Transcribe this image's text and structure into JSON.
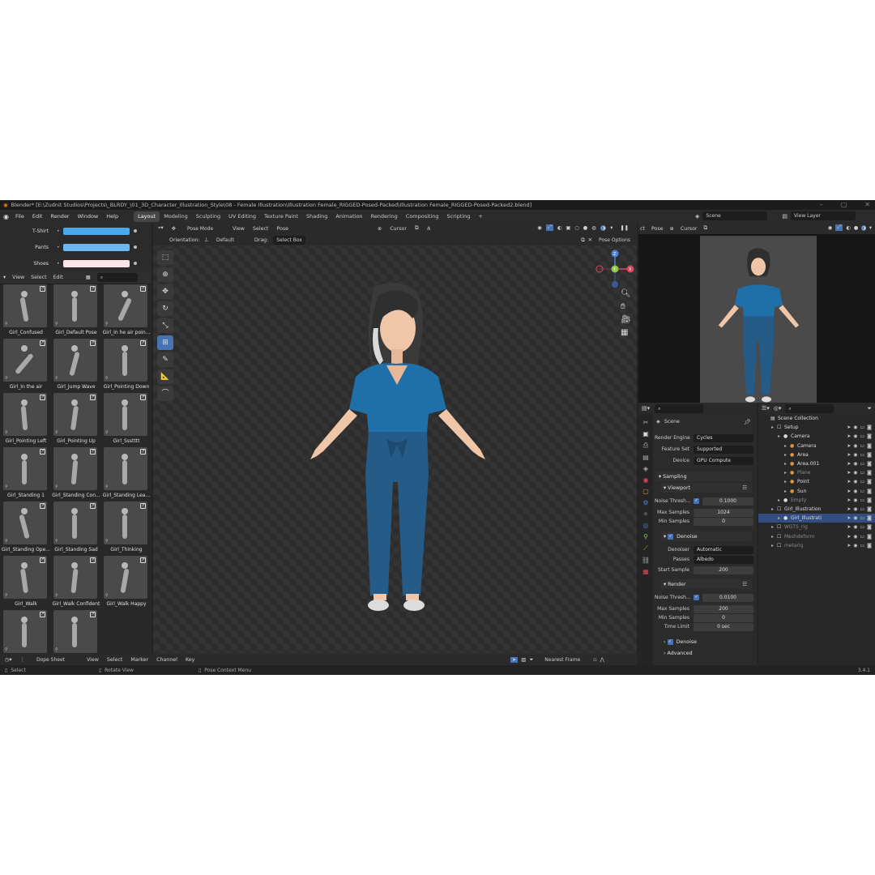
{
  "title": "Blender* [E:\\Zudnit Studios\\Projects\\_BLRDY_\\01_3D_Character_Illustration_Style\\08 - Female Illustration\\Illustration Female_RIGGED-Posed-Packed\\Illustration Female_RIGGED-Posed-Packed2.blend]",
  "menu": [
    "File",
    "Edit",
    "Render",
    "Window",
    "Help"
  ],
  "workspaces": [
    "Layout",
    "Modeling",
    "Sculpting",
    "UV Editing",
    "Texture Paint",
    "Shading",
    "Animation",
    "Rendering",
    "Compositing",
    "Scripting"
  ],
  "scene_field": "Scene",
  "view_layer_field": "View Layer",
  "colors_panel": [
    {
      "label": "T-Shirt",
      "color": "#4aa8e8"
    },
    {
      "label": "Pants",
      "color": "#6db7ee"
    },
    {
      "label": "Shoes",
      "color": "#fbe3e8"
    }
  ],
  "asset_header": [
    "View",
    "Select",
    "Edit"
  ],
  "poses": [
    "Girl_Confused",
    "Girl_Default Pose",
    "Girl_In he air poin...",
    "Girl_In the air",
    "Girl_Jump Wave",
    "Girl_Pointing Down",
    "Girl_Pointing Left",
    "Girl_Pointing Up",
    "Girl_Ssstttt",
    "Girl_Standing 1",
    "Girl_Standing Con...",
    "Girl_Standing Lea...",
    "Girl_Standing Ope...",
    "Girl_Standing Sad",
    "Girl_Thinking",
    "Girl_Walk",
    "Girl_Walk Confident",
    "Girl_Walk Happy",
    "",
    ""
  ],
  "viewport": {
    "mode": "Pose Mode",
    "menus": [
      "View",
      "Select",
      "Pose"
    ],
    "cursor": "Cursor",
    "orientation_label": "Orientation:",
    "orientation": "Default",
    "drag_label": "Drag:",
    "drag": "Select Box",
    "pose_options": "Pose Options"
  },
  "camera_header": [
    "ct",
    "Pose",
    "Cursor"
  ],
  "properties": {
    "scene": "Scene",
    "render_engine_label": "Render Engine",
    "render_engine": "Cycles",
    "feature_set_label": "Feature Set",
    "feature_set": "Supported",
    "device_label": "Device",
    "device": "GPU Compute",
    "sampling": "Sampling",
    "viewport": "Viewport",
    "noise_label": "Noise Thresh...",
    "noise_vp": "0.1000",
    "max_samples_label": "Max Samples",
    "max_vp": "1024",
    "min_samples_label": "Min Samples",
    "min_vp": "0",
    "denoise": "Denoise",
    "denoiser_label": "Denoiser",
    "denoiser": "Automatic",
    "passes_label": "Passes",
    "passes": "Albedo",
    "start_sample_label": "Start Sample",
    "start_sample": "200",
    "render": "Render",
    "noise_r": "0.0100",
    "max_r": "200",
    "min_r": "0",
    "time_limit_label": "Time Limit",
    "time_limit": "0 sec",
    "denoise2": "Denoise",
    "advanced": "Advanced"
  },
  "outliner": [
    {
      "label": "Scene Collection",
      "indent": 0
    },
    {
      "label": "Setup",
      "indent": 1
    },
    {
      "label": "Camera",
      "indent": 2
    },
    {
      "label": "Camera",
      "indent": 3
    },
    {
      "label": "Area",
      "indent": 3
    },
    {
      "label": "Area.001",
      "indent": 3
    },
    {
      "label": "Plane",
      "indent": 3
    },
    {
      "label": "Point",
      "indent": 3
    },
    {
      "label": "Sun",
      "indent": 3
    },
    {
      "label": "Empty",
      "indent": 2
    },
    {
      "label": "Girl_Illustration",
      "indent": 1
    },
    {
      "label": "Girl_Illustrati",
      "indent": 2
    },
    {
      "label": "WGTS_rig",
      "indent": 1
    },
    {
      "label": "Meshdeform",
      "indent": 1
    },
    {
      "label": "metarig",
      "indent": 1
    }
  ],
  "dope": {
    "editor": "Dope Sheet",
    "menus": [
      "View",
      "Select",
      "Marker",
      "Channel",
      "Key"
    ],
    "snap": "Nearest Frame"
  },
  "status": {
    "select": "Select",
    "rotate": "Rotate View",
    "context": "Pose Context Menu",
    "version": "3.4.1"
  },
  "accent": "#4772b3"
}
